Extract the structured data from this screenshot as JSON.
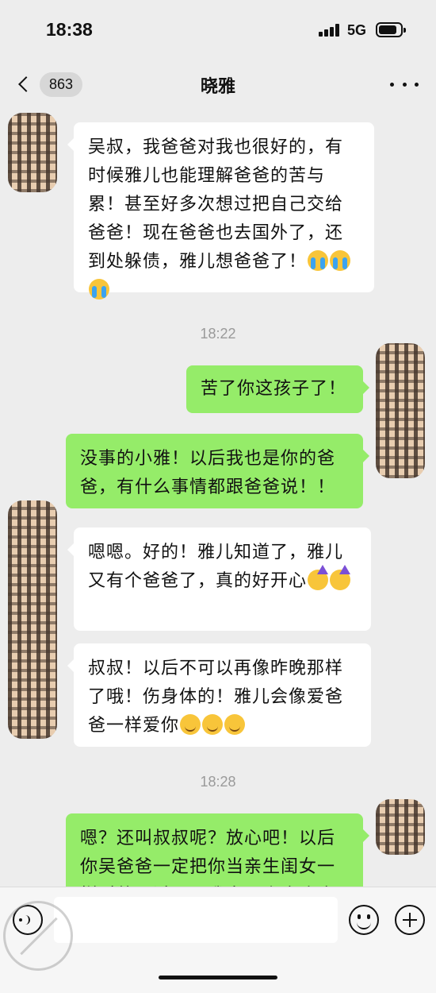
{
  "status_bar": {
    "time": "18:38",
    "network": "5G"
  },
  "nav": {
    "unread_badge": "863",
    "title": "晓雅"
  },
  "messages": {
    "m1": {
      "text": "吴叔，我爸爸对我也很好的，有时候雅儿也能理解爸爸的苦与累！甚至好多次想过把自己交给爸爸！现在爸爸也去国外了，还到处躲债，雅儿想爸爸了！",
      "emojis": [
        "cry-emoji",
        "cry-emoji",
        "cry-emoji"
      ]
    },
    "t1": "18:22",
    "m2": {
      "text": "苦了你这孩子了！"
    },
    "m3": {
      "text": "没事的小雅！以后我也是你的爸爸，有什么事情都跟爸爸说！！"
    },
    "m4": {
      "text": "嗯嗯。好的！雅儿知道了，雅儿又有个爸爸了，真的好开心",
      "emojis": [
        "party-emoji",
        "party-emoji"
      ]
    },
    "m5": {
      "text": "叔叔！以后不可以再像昨晚那样了哦！伤身体的！雅儿会像爱爸爸一样爱你",
      "emojis": [
        "smile-emoji",
        "smile-emoji",
        "smile-emoji"
      ]
    },
    "t2": "18:28",
    "m6": {
      "text": "嗯？还叫叔叔呢？放心吧！以后你吴爸爸一定把你当亲生闺女一样对待，过两天我家那小魔头也"
    }
  },
  "input_bar": {
    "placeholder": ""
  },
  "colors": {
    "background": "#ededed",
    "bubble_left": "#ffffff",
    "bubble_right": "#95ec69"
  }
}
